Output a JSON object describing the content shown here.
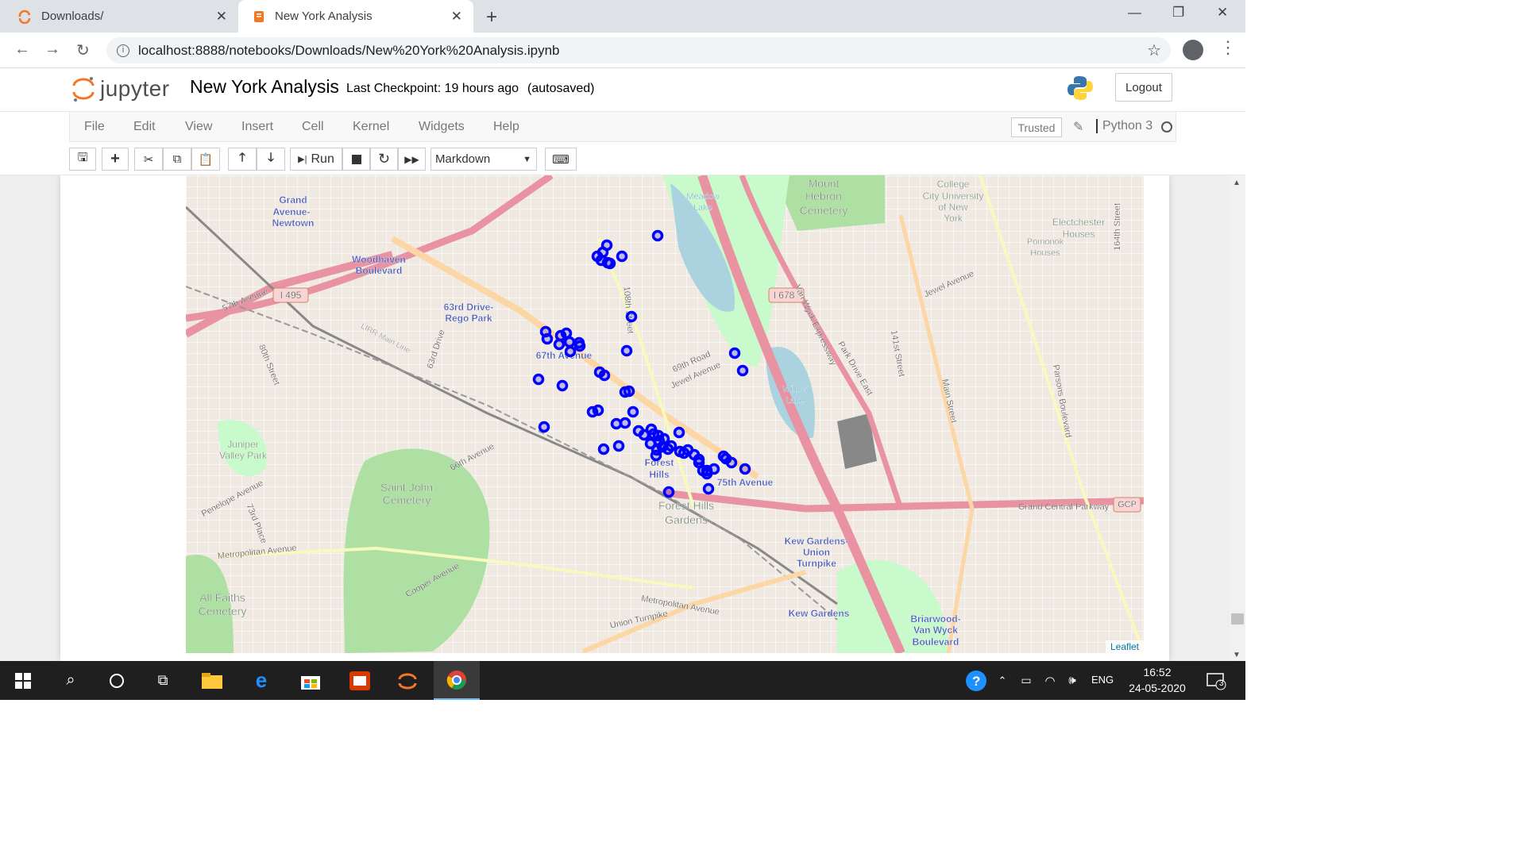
{
  "browser": {
    "tabs": [
      {
        "title": "Downloads/"
      },
      {
        "title": "New York Analysis"
      }
    ],
    "url": "localhost:8888/notebooks/Downloads/New%20York%20Analysis.ipynb"
  },
  "jupyter": {
    "logo_text": "jupyter",
    "notebook_name": "New York Analysis",
    "checkpoint": "Last Checkpoint: 19 hours ago",
    "autosave": "(autosaved)",
    "logout_label": "Logout",
    "menus": [
      "File",
      "Edit",
      "View",
      "Insert",
      "Cell",
      "Kernel",
      "Widgets",
      "Help"
    ],
    "trusted_label": "Trusted",
    "kernel_name": "Python 3",
    "toolbar": {
      "run_label": "Run",
      "cell_type": "Markdown"
    }
  },
  "map": {
    "attribution": "Leaflet",
    "marker_color": "#0000ff",
    "labels": [
      {
        "text": "Grand"
      },
      {
        "text": "Avenue-"
      },
      {
        "text": "Newtown"
      },
      {
        "text": "Woodhaven"
      },
      {
        "text": "Boulevard"
      },
      {
        "text": "63rd Drive-"
      },
      {
        "text": "Rego Park"
      },
      {
        "text": "67th Avenue"
      },
      {
        "text": "Forest"
      },
      {
        "text": "Hills"
      },
      {
        "text": "75th Avenue"
      },
      {
        "text": "Kew Gardens-"
      },
      {
        "text": "Union"
      },
      {
        "text": "Turnpike"
      },
      {
        "text": "Kew Gardens"
      },
      {
        "text": "Briarwood-"
      },
      {
        "text": "Van Wyck"
      },
      {
        "text": "Boulevard"
      },
      {
        "text": "Mount"
      },
      {
        "text": "Hebron"
      },
      {
        "text": "Cemetery"
      },
      {
        "text": "Meadow"
      },
      {
        "text": "Lake"
      },
      {
        "text": "Willow"
      },
      {
        "text": "Lake"
      },
      {
        "text": "Juniper"
      },
      {
        "text": "Valley Park"
      },
      {
        "text": "Saint John"
      },
      {
        "text": "Cemetery"
      },
      {
        "text": "All Faiths"
      },
      {
        "text": "Cemetery"
      },
      {
        "text": "Forest Hills"
      },
      {
        "text": "Gardens"
      },
      {
        "text": "College"
      },
      {
        "text": "City University"
      },
      {
        "text": "of New"
      },
      {
        "text": "York"
      },
      {
        "text": "Electchester"
      },
      {
        "text": "Houses"
      },
      {
        "text": "Pomonok"
      },
      {
        "text": "Houses"
      },
      {
        "text": "I 495"
      },
      {
        "text": "I 678"
      },
      {
        "text": "Grand Central Parkway"
      },
      {
        "text": "GCP"
      },
      {
        "text": "57th Avenue"
      },
      {
        "text": "80th Street"
      },
      {
        "text": "63rd Drive"
      },
      {
        "text": "66th Avenue"
      },
      {
        "text": "69th Road"
      },
      {
        "text": "Jewel Avenue"
      },
      {
        "text": "108th Street"
      },
      {
        "text": "Metropolitan Avenue"
      },
      {
        "text": "Cooper Avenue"
      },
      {
        "text": "Metropolitan Avenue"
      },
      {
        "text": "Union Turnpike"
      },
      {
        "text": "Penelope Avenue"
      },
      {
        "text": "73rd Place"
      },
      {
        "text": "Park Drive East"
      },
      {
        "text": "Van Wyck Expressway"
      },
      {
        "text": "141st Street"
      },
      {
        "text": "Main Street"
      },
      {
        "text": "Parsons Boulevard"
      },
      {
        "text": "164th Street"
      },
      {
        "text": "Jewel Avenue"
      },
      {
        "text": "LIRR Main Line"
      }
    ]
  },
  "taskbar": {
    "time": "16:52",
    "date": "24-05-2020",
    "language": "ENG",
    "notification_count": "3"
  }
}
